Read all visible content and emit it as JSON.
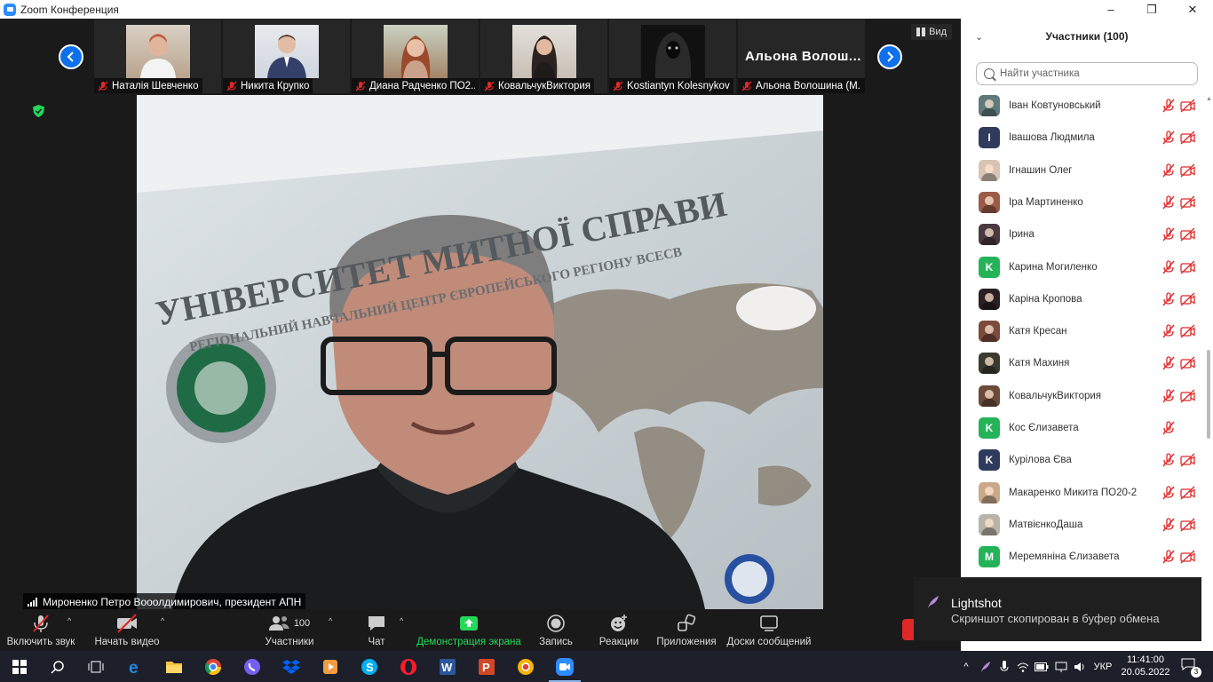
{
  "window": {
    "title": "Zoom Конференция",
    "minimize": "–",
    "maximize": "❐",
    "close": "✕"
  },
  "thumbnails": [
    {
      "name": "Наталія Шевченко",
      "kind": "photo",
      "color": "#b58a6a"
    },
    {
      "name": "Никита Крупко",
      "kind": "photo",
      "color": "#5d6e8a"
    },
    {
      "name": "Диана Радченко ПО2...",
      "kind": "photo",
      "color": "#a0583f"
    },
    {
      "name": "КовальчукВиктория",
      "kind": "photo",
      "color": "#6b4a3a"
    },
    {
      "name": "Kostiantyn Kolesnykov",
      "kind": "photo",
      "color": "#222222"
    },
    {
      "name": "Альона Волошина (М...",
      "kind": "text",
      "display": "Альона Волош..."
    }
  ],
  "view_button": {
    "label": "Вид"
  },
  "speaker": {
    "label": "Мироненко Петро Вооолдимирович, президент АПН"
  },
  "background_sign": {
    "line1": "УНІВЕРСИТЕТ МИТНОЇ СПРАВИ",
    "line2": "РЕГІОНАЛЬНИЙ НАВЧАЛЬНИЙ ЦЕНТР ЄВРОПЕЙСЬКОГО РЕГІОНУ ВСЕСВ"
  },
  "toolbar": {
    "unmute": "Включить звук",
    "start_video": "Начать видео",
    "participants": "Участники",
    "participants_count": "100",
    "chat": "Чат",
    "share": "Демонстрация экрана",
    "record": "Запись",
    "reactions": "Реакции",
    "apps": "Приложения",
    "whiteboards": "Доски сообщений"
  },
  "panel": {
    "title": "Участники (100)",
    "search_placeholder": "Найти участника",
    "participants": [
      {
        "name": "Іван Ковтуновський",
        "avatar": "photo",
        "color": "#5e7a7a",
        "initial": "",
        "cam_off": true
      },
      {
        "name": "Івашова Людмила",
        "avatar": "letter",
        "color": "#2f3b5c",
        "initial": "I",
        "cam_off": true
      },
      {
        "name": "Ігнашин Олег",
        "avatar": "photo",
        "color": "#d8c3b5",
        "initial": "",
        "cam_off": true
      },
      {
        "name": "Іра Мартиненко",
        "avatar": "photo",
        "color": "#9a5b47",
        "initial": "",
        "cam_off": true
      },
      {
        "name": "Ірина",
        "avatar": "photo",
        "color": "#4a3a40",
        "initial": "",
        "cam_off": true
      },
      {
        "name": "Карина Могиленко",
        "avatar": "letter",
        "color": "#25b35a",
        "initial": "K",
        "cam_off": true
      },
      {
        "name": "Каріна Кропова",
        "avatar": "photo",
        "color": "#2a1f22",
        "initial": "",
        "cam_off": true
      },
      {
        "name": "Катя Кресан",
        "avatar": "photo",
        "color": "#7c4b3b",
        "initial": "",
        "cam_off": true
      },
      {
        "name": "Катя Махиня",
        "avatar": "photo",
        "color": "#3c3a2e",
        "initial": "",
        "cam_off": true
      },
      {
        "name": "КовальчукВиктория",
        "avatar": "photo",
        "color": "#6b4a3a",
        "initial": "",
        "cam_off": true
      },
      {
        "name": "Кос  Єлизавета",
        "avatar": "letter",
        "color": "#25b35a",
        "initial": "K",
        "cam_off": false
      },
      {
        "name": "Курілова Єва",
        "avatar": "letter",
        "color": "#2f3b5c",
        "initial": "K",
        "cam_off": true
      },
      {
        "name": "Макаренко Микита ПО20-2",
        "avatar": "photo",
        "color": "#c9a98a",
        "initial": "",
        "cam_off": true
      },
      {
        "name": "МатвієнкоДаша",
        "avatar": "photo",
        "color": "#b9b4a8",
        "initial": "",
        "cam_off": true
      },
      {
        "name": "Меремяніна Єлизавета",
        "avatar": "letter",
        "color": "#25b35a",
        "initial": "M",
        "cam_off": true
      }
    ]
  },
  "toast": {
    "title": "Lightshot",
    "message": "Скриншот скопирован в буфер обмена"
  },
  "taskbar": {
    "language": "УКР",
    "time": "11:41:00",
    "date": "20.05.2022",
    "notifications": "3",
    "apps": [
      "start",
      "search",
      "task-view",
      "edge",
      "file-explorer",
      "chrome",
      "viber",
      "dropbox",
      "media-player",
      "skype",
      "opera",
      "word",
      "powerpoint",
      "chrome-canary",
      "zoom"
    ]
  },
  "colors": {
    "accent_blue": "#0e71eb",
    "share_green": "#23d959",
    "mute_red": "#e02828"
  }
}
